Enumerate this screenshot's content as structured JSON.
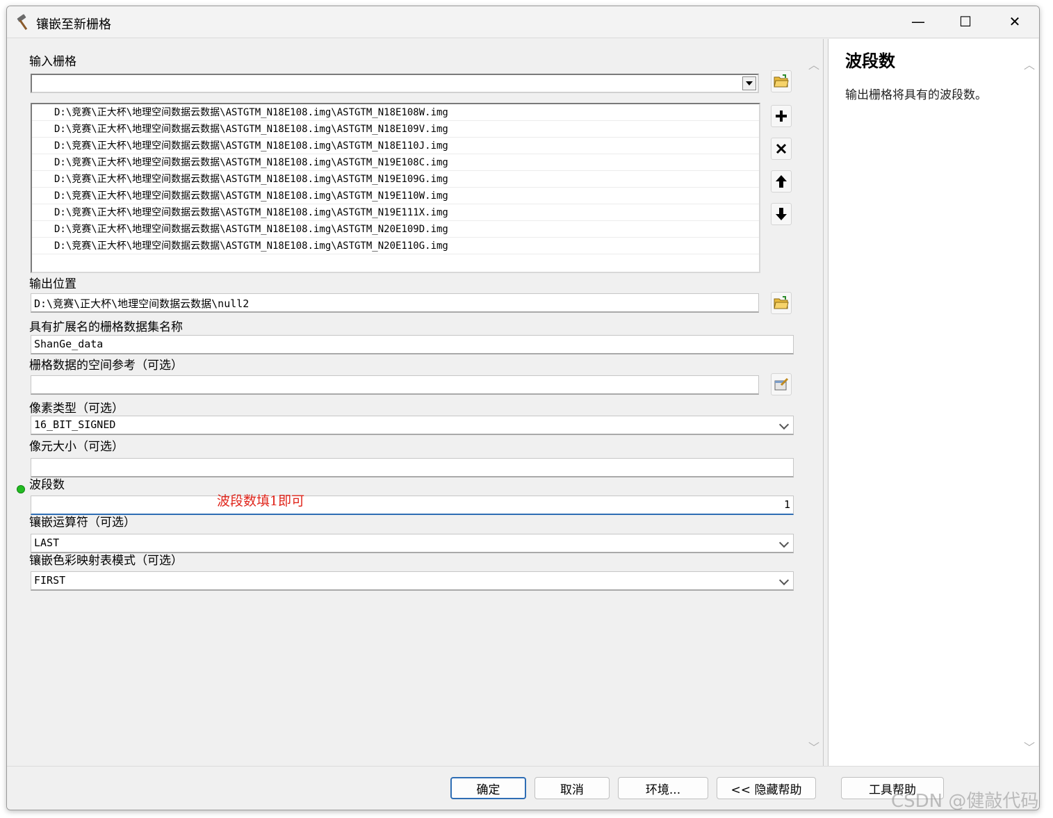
{
  "window": {
    "title": "镶嵌至新栅格",
    "minimize_symbol": "—",
    "maximize_symbol": "☐",
    "close_symbol": "✕"
  },
  "form": {
    "input_rasters": {
      "label": "输入栅格",
      "value": "",
      "items": [
        "D:\\竞赛\\正大杯\\地理空间数据云数据\\ASTGTM_N18E108.img\\ASTGTM_N18E108W.img",
        "D:\\竞赛\\正大杯\\地理空间数据云数据\\ASTGTM_N18E108.img\\ASTGTM_N18E109V.img",
        "D:\\竞赛\\正大杯\\地理空间数据云数据\\ASTGTM_N18E108.img\\ASTGTM_N18E110J.img",
        "D:\\竞赛\\正大杯\\地理空间数据云数据\\ASTGTM_N18E108.img\\ASTGTM_N19E108C.img",
        "D:\\竞赛\\正大杯\\地理空间数据云数据\\ASTGTM_N18E108.img\\ASTGTM_N19E109G.img",
        "D:\\竞赛\\正大杯\\地理空间数据云数据\\ASTGTM_N18E108.img\\ASTGTM_N19E110W.img",
        "D:\\竞赛\\正大杯\\地理空间数据云数据\\ASTGTM_N18E108.img\\ASTGTM_N19E111X.img",
        "D:\\竞赛\\正大杯\\地理空间数据云数据\\ASTGTM_N18E108.img\\ASTGTM_N20E109D.img",
        "D:\\竞赛\\正大杯\\地理空间数据云数据\\ASTGTM_N18E108.img\\ASTGTM_N20E110G.img"
      ]
    },
    "output_location": {
      "label": "输出位置",
      "value": "D:\\竞赛\\正大杯\\地理空间数据云数据\\null2"
    },
    "dataset_name": {
      "label": "具有扩展名的栅格数据集名称",
      "value": "ShanGe_data"
    },
    "spatial_ref": {
      "label": "栅格数据的空间参考（可选）",
      "value": ""
    },
    "pixel_type": {
      "label": "像素类型（可选）",
      "value": "16_BIT_SIGNED"
    },
    "cellsize": {
      "label": "像元大小（可选）",
      "value": ""
    },
    "bands": {
      "label": "波段数",
      "value": "1",
      "annotation": "波段数填1即可"
    },
    "mosaic_operator": {
      "label": "镶嵌运算符（可选）",
      "value": "LAST"
    },
    "colormap_mode": {
      "label": "镶嵌色彩映射表模式（可选）",
      "value": "FIRST"
    }
  },
  "help": {
    "title": "波段数",
    "description": "输出栅格将具有的波段数。"
  },
  "footer": {
    "ok": "确定",
    "cancel": "取消",
    "env": "环境...",
    "hide_help": "<< 隐藏帮助",
    "tool_help": "工具帮助"
  },
  "watermark": "CSDN @健敲代码",
  "colors": {
    "accent": "#2e6db4",
    "annotation": "#e0261c",
    "required_dot": "#22bb22"
  }
}
